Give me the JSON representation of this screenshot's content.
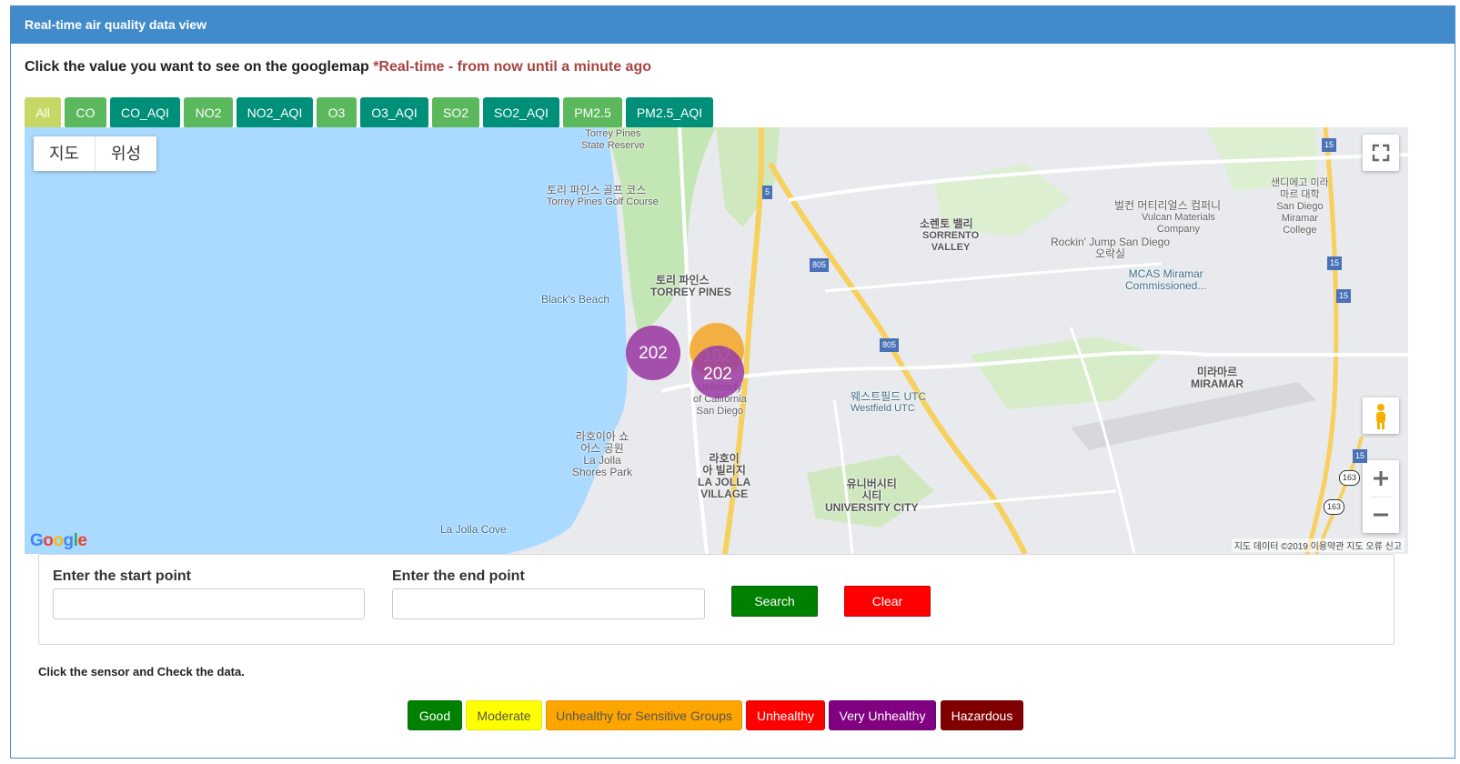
{
  "header": {
    "title": "Real-time air quality data view"
  },
  "instruction": {
    "text": "Click the value you want to see on the googlemap",
    "realtime_note": "*Real-time - from now until a minute ago"
  },
  "filters": [
    {
      "label": "All",
      "color": "#c6d766"
    },
    {
      "label": "CO",
      "color": "#5cb85c"
    },
    {
      "label": "CO_AQI",
      "color": "#00907a"
    },
    {
      "label": "NO2",
      "color": "#5cb85c"
    },
    {
      "label": "NO2_AQI",
      "color": "#00907a"
    },
    {
      "label": "O3",
      "color": "#5cb85c"
    },
    {
      "label": "O3_AQI",
      "color": "#00907a"
    },
    {
      "label": "SO2",
      "color": "#5cb85c"
    },
    {
      "label": "SO2_AQI",
      "color": "#00907a"
    },
    {
      "label": "PM2.5",
      "color": "#5cb85c"
    },
    {
      "label": "PM2.5_AQI",
      "color": "#00907a"
    }
  ],
  "map": {
    "type_toggle": {
      "map": "지도",
      "satellite": "위성"
    },
    "clusters": [
      {
        "value": "202",
        "color": "#9b3ea3"
      },
      {
        "value": "102",
        "color": "#f5a623"
      },
      {
        "value": "202",
        "color": "#9b3ea3"
      }
    ],
    "labels": {
      "torrey_state": "Torrey Pines\nState Reserve",
      "golf_ko": "토리 파인스 골프 코스",
      "golf_en": "Torrey Pines Golf Course",
      "torrey_ko": "토리 파인스",
      "torrey_en": "TORREY PINES",
      "blacks_beach": "Black's Beach",
      "sorrento_ko": "소렌토 밸리",
      "sorrento_en": "SORRENTO\nVALLEY",
      "vulcan_ko": "벌컨 머티리얼스 컴퍼니",
      "vulcan_en": "Vulcan Materials\nCompany",
      "rockin": "Rockin' Jump San Diego\n오락실",
      "miramar_college": "샌디에고 미라\n마르 대학\nSan Diego\nMiramar\nCollege",
      "mcas": "MCAS Miramar\nCommissioned...",
      "miramar": "미라마르\nMIRAMAR",
      "ucsd": "University\nof California\nSan Diego",
      "westfield_ko": "웨스트필드 UTC",
      "westfield_en": "Westfield UTC",
      "lajolla_shores": "라호이아 쇼\n어스 공원\nLa Jolla\nShores Park",
      "lajolla_village": "라호이\n아 빌리지\nLA JOLLA\nVILLAGE",
      "university_city": "유니버시티\n시티\nUNIVERSITY CITY",
      "lajolla_cove": "La Jolla Cove"
    },
    "highway_shields": [
      "5",
      "805",
      "805",
      "15",
      "15",
      "15",
      "15",
      "163",
      "163"
    ],
    "attribution": "지도 데이터 ©2019   이용약관   지도 오류 신고",
    "logo": "Google"
  },
  "route": {
    "start_label": "Enter the start point",
    "start_value": "",
    "end_label": "Enter the end point",
    "end_value": "",
    "search_label": "Search",
    "clear_label": "Clear",
    "search_color": "#008000",
    "clear_color": "#ff0000"
  },
  "help_text": "Click the sensor and Check the data.",
  "legend": [
    {
      "label": "Good",
      "color": "#008000",
      "text_color": "#ffffff"
    },
    {
      "label": "Moderate",
      "color": "#ffff00",
      "text_color": "#555555"
    },
    {
      "label": "Unhealthy for Sensitive Groups",
      "color": "#ffa500",
      "text_color": "#555555"
    },
    {
      "label": "Unhealthy",
      "color": "#ff0000",
      "text_color": "#ffffff"
    },
    {
      "label": "Very Unhealthy",
      "color": "#800080",
      "text_color": "#ffffff"
    },
    {
      "label": "Hazardous",
      "color": "#800000",
      "text_color": "#ffffff"
    }
  ]
}
